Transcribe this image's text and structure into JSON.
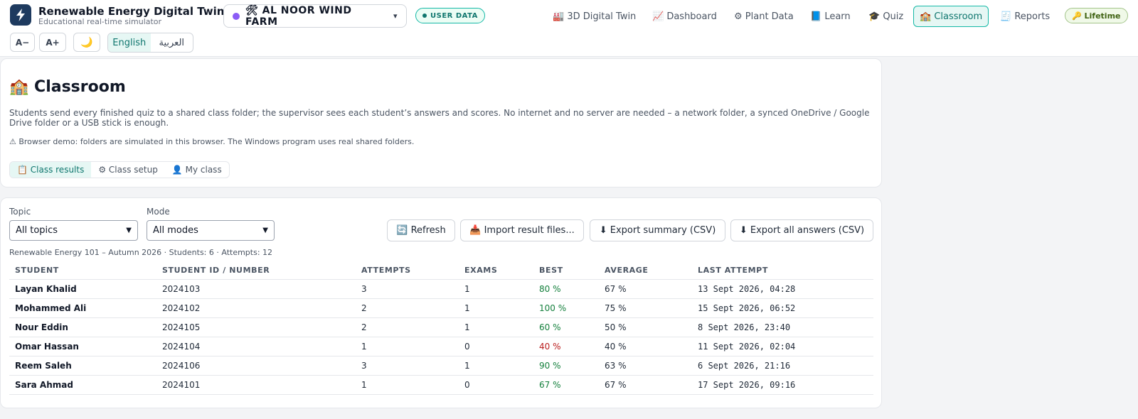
{
  "app": {
    "title": "Renewable Energy Digital Twin",
    "subtitle": "Educational real-time simulator"
  },
  "plant": {
    "name": "🛠 AL NOOR WIND FARM",
    "caret": "▾"
  },
  "badges": {
    "user_data": "USER DATA",
    "lifetime": "🔑 Lifetime"
  },
  "nav": [
    {
      "label": "🏭 3D Digital Twin"
    },
    {
      "label": "📈 Dashboard"
    },
    {
      "label": "⚙ Plant Data"
    },
    {
      "label": "📘 Learn"
    },
    {
      "label": "🎓 Quiz"
    },
    {
      "label": "🏫 Classroom"
    },
    {
      "label": "🧾 Reports"
    }
  ],
  "controls": {
    "font_smaller": "A−",
    "font_larger": "A+",
    "dark_mode": "🌙",
    "lang_en": "English",
    "lang_ar": "العربية"
  },
  "page": {
    "title": "🏫 Classroom",
    "description": "Students send every finished quiz to a shared class folder; the supervisor sees each student’s answers and scores. No internet and no server are needed – a network folder, a synced OneDrive / Google Drive folder or a USB stick is enough.",
    "warning": "⚠ Browser demo: folders are simulated in this browser. The Windows program uses real shared folders."
  },
  "tabs": [
    {
      "label": "📋 Class results"
    },
    {
      "label": "⚙ Class setup"
    },
    {
      "label": "👤 My class"
    }
  ],
  "filters": {
    "topic_label": "Topic",
    "topic_value": "All topics",
    "mode_label": "Mode",
    "mode_value": "All modes"
  },
  "actions": {
    "refresh": "🔄 Refresh",
    "import": "📥 Import result files...",
    "export_summary": "⬇ Export summary (CSV)",
    "export_all": "⬇ Export all answers (CSV)"
  },
  "summary": "Renewable Energy 101 – Autumn 2026 · Students: 6 · Attempts: 12",
  "table": {
    "headers": [
      "STUDENT",
      "STUDENT ID / NUMBER",
      "ATTEMPTS",
      "EXAMS",
      "BEST",
      "AVERAGE",
      "LAST ATTEMPT"
    ],
    "rows": [
      {
        "student": "Layan Khalid",
        "id": "2024103",
        "attempts": "3",
        "exams": "1",
        "best": "80 %",
        "average": "67 %",
        "last": "13 Sept 2026, 04:28"
      },
      {
        "student": "Mohammed Ali",
        "id": "2024102",
        "attempts": "2",
        "exams": "1",
        "best": "100 %",
        "average": "75 %",
        "last": "15 Sept 2026, 06:52"
      },
      {
        "student": "Nour Eddin",
        "id": "2024105",
        "attempts": "2",
        "exams": "1",
        "best": "60 %",
        "average": "50 %",
        "last": "8 Sept 2026, 23:40"
      },
      {
        "student": "Omar Hassan",
        "id": "2024104",
        "attempts": "1",
        "exams": "0",
        "best": "40 %",
        "average": "40 %",
        "last": "11 Sept 2026, 02:04"
      },
      {
        "student": "Reem Saleh",
        "id": "2024106",
        "attempts": "3",
        "exams": "1",
        "best": "90 %",
        "average": "63 %",
        "last": "6 Sept 2026, 21:16"
      },
      {
        "student": "Sara Ahmad",
        "id": "2024101",
        "attempts": "1",
        "exams": "0",
        "best": "67 %",
        "average": "67 %",
        "last": "17 Sept 2026, 09:16"
      }
    ]
  },
  "colors": {
    "accent": "#0f766e",
    "pass": "#15803d",
    "fail": "#b91c1c",
    "logo_bg": "#1e3a5f",
    "plant_dot": "#8b5cf6"
  }
}
